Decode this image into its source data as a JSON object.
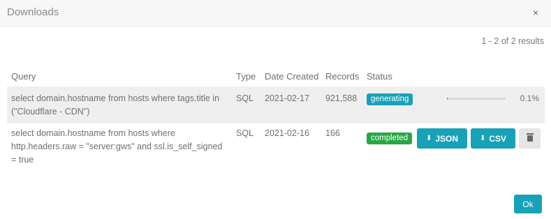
{
  "modal": {
    "title": "Downloads",
    "close_icon": "×",
    "results_text": "1 - 2 of 2 results",
    "ok_label": "Ok"
  },
  "table": {
    "headers": {
      "query": "Query",
      "type": "Type",
      "date_created": "Date Created",
      "records": "Records",
      "status": "Status"
    },
    "rows": [
      {
        "query_line1": "select domain.hostname from hosts where tags.title in",
        "query_line2": "(\"Cloudflare - CDN\")",
        "type": "SQL",
        "date_created": "2021-02-17",
        "records": "921,588",
        "status": "generating",
        "progress_percent": 0.1,
        "progress_text": "0.1%"
      },
      {
        "query_line1": "select domain.hostname from hosts where",
        "query_line2": "http.headers.raw = \"server:gws\" and ssl.is_self_signed",
        "query_line3": "= true",
        "type": "SQL",
        "date_created": "2021-02-16",
        "records": "166",
        "status": "completed",
        "json_label": "JSON",
        "csv_label": "CSV",
        "download_icon": "download-icon",
        "trash_icon": "trash-icon"
      }
    ]
  },
  "colors": {
    "accent": "#17a2b8",
    "completed": "#28a745",
    "header_bg": "#f7f7f7"
  }
}
